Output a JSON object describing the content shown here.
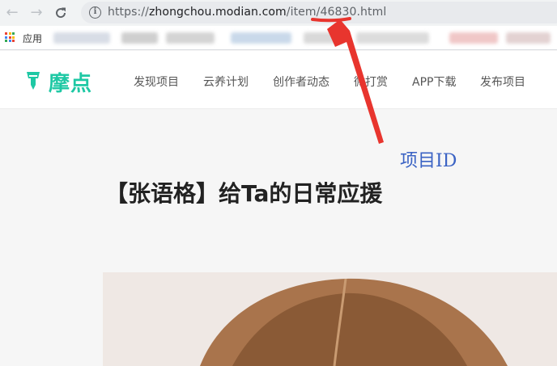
{
  "browser": {
    "url_scheme": "https://",
    "url_host": "zhongchou.modian.com",
    "url_path": "/item/46830.html",
    "bookmarks_apps_label": "应用"
  },
  "site": {
    "logo_text": "摩点",
    "nav": [
      {
        "label": "发现项目"
      },
      {
        "label": "云养计划"
      },
      {
        "label": "创作者动态"
      },
      {
        "label": "微打赏"
      },
      {
        "label": "APP下载"
      },
      {
        "label": "发布项目"
      }
    ]
  },
  "project": {
    "title": "【张语格】给Ta的日常应援"
  },
  "annotation": {
    "label": "项目ID",
    "color": "#e8352e",
    "text_color": "#3b63c4"
  },
  "colors": {
    "brand": "#1ec8a4"
  }
}
